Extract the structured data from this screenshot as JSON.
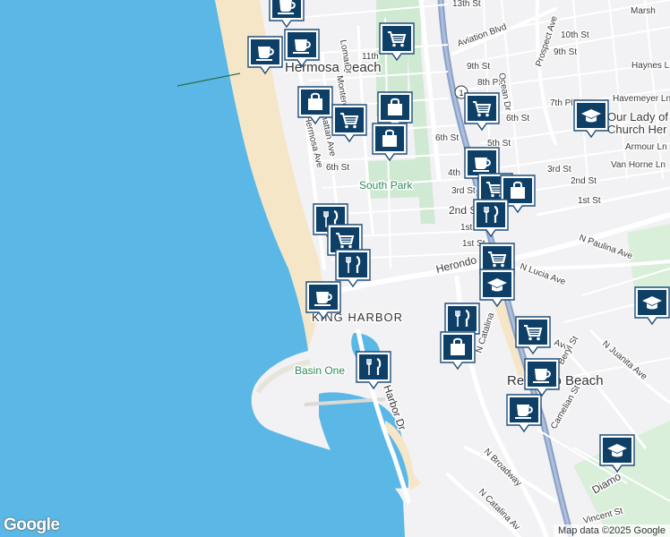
{
  "map": {
    "colors": {
      "water": "#5bb8e6",
      "sand": "#f5e6c8",
      "land": "#f2f2f4",
      "park": "#cfe9d2",
      "highway": "#8aa0c6",
      "road": "#ffffff",
      "marker": "#0e3f66"
    },
    "places": [
      "Hermosa Beach",
      "KING HARBOR",
      "Redondo Beach"
    ],
    "parks": [
      "South Park",
      "Basin One"
    ],
    "streets": [
      "13th St",
      "Aviation Blvd",
      "Prospect Ave",
      "Marsh",
      "10th St",
      "9th St",
      "Haynes Ln",
      "Loma Dr",
      "11th",
      "9th St",
      "8th Pl",
      "Ocean Dr",
      "7th Pl",
      "Havemeyer Ln",
      "Monterey",
      "Manhattan Ave",
      "Hermosa Ave",
      "6th St",
      "6th St",
      "6th St",
      "5th St",
      "Armour Ln",
      "3rd St",
      "Van Horne Ln",
      "4th",
      "3rd St",
      "2nd St",
      "2nd St",
      "1st St",
      "1st",
      "1st St",
      "N Paulina Ave",
      "Herondo St",
      "N Lucia Ave",
      "N Catalina",
      "Ave",
      "Beryl St",
      "N Juanita Ave",
      "Camelian St",
      "Harbor Dr",
      "N Broadway",
      "N Catalina Av",
      "Diamo",
      "Vincent St",
      "Our Lady of",
      "Church Her"
    ],
    "route_shield": "1",
    "attribution": "Map data ©2025 Google",
    "logo": "Google"
  },
  "markers": [
    {
      "icon": "coffee-icon",
      "type": "cafe"
    },
    {
      "icon": "coffee-icon",
      "type": "cafe"
    },
    {
      "icon": "coffee-icon",
      "type": "cafe"
    },
    {
      "icon": "cart-icon",
      "type": "grocery"
    },
    {
      "icon": "shopping-bag-icon",
      "type": "store"
    },
    {
      "icon": "cart-icon",
      "type": "grocery"
    },
    {
      "icon": "shopping-bag-icon",
      "type": "store"
    },
    {
      "icon": "shopping-bag-icon",
      "type": "store"
    },
    {
      "icon": "cart-icon",
      "type": "grocery"
    },
    {
      "icon": "graduation-cap-icon",
      "type": "school"
    },
    {
      "icon": "coffee-icon",
      "type": "cafe"
    },
    {
      "icon": "cart-icon",
      "type": "grocery"
    },
    {
      "icon": "shopping-bag-icon",
      "type": "store"
    },
    {
      "icon": "restaurant-icon",
      "type": "restaurant"
    },
    {
      "icon": "restaurant-icon",
      "type": "restaurant"
    },
    {
      "icon": "cart-icon",
      "type": "grocery"
    },
    {
      "icon": "restaurant-icon",
      "type": "restaurant"
    },
    {
      "icon": "coffee-icon",
      "type": "cafe"
    },
    {
      "icon": "cart-icon",
      "type": "grocery"
    },
    {
      "icon": "graduation-cap-icon",
      "type": "school"
    },
    {
      "icon": "restaurant-icon",
      "type": "restaurant"
    },
    {
      "icon": "shopping-bag-icon",
      "type": "store"
    },
    {
      "icon": "cart-icon",
      "type": "grocery"
    },
    {
      "icon": "graduation-cap-icon",
      "type": "school"
    },
    {
      "icon": "restaurant-icon",
      "type": "restaurant"
    },
    {
      "icon": "coffee-icon",
      "type": "cafe"
    },
    {
      "icon": "coffee-icon",
      "type": "cafe"
    },
    {
      "icon": "graduation-cap-icon",
      "type": "school"
    }
  ]
}
